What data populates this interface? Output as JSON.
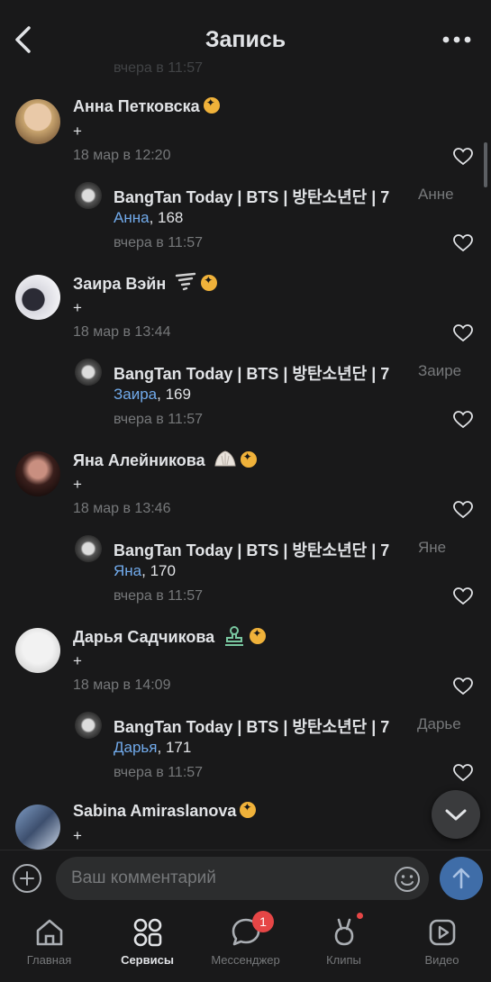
{
  "header": {
    "title": "Запись"
  },
  "faded_prev_date": "вчера в 11:57",
  "comments": [
    {
      "name": "Анна Петковска",
      "text": "+",
      "date": "18 мар в 12:20",
      "emoji": "",
      "reply": {
        "author": "BangTan Today | BTS | 방탄소년단 | 7",
        "to": "Анне",
        "mention": "Анна",
        "number": ", 168",
        "date": "вчера в 11:57"
      }
    },
    {
      "name": "Заира Вэйн",
      "text": "+",
      "date": "18 мар в 13:44",
      "emoji": "tornado-emoji",
      "reply": {
        "author": "BangTan Today | BTS | 방탄소년단 | 7",
        "to": "Заире",
        "mention": "Заира",
        "number": ", 169",
        "date": "вчера в 11:57"
      }
    },
    {
      "name": "Яна Алейникова",
      "text": "+",
      "date": "18 мар в 13:46",
      "emoji": "dumpling-emoji",
      "reply": {
        "author": "BangTan Today | BTS | 방탄소년단 | 7",
        "to": "Яне",
        "mention": "Яна",
        "number": ", 170",
        "date": "вчера в 11:57"
      }
    },
    {
      "name": "Дарья Садчикова",
      "text": "+",
      "date": "18 мар в 14:09",
      "emoji": "stamp-emoji",
      "reply": {
        "author": "BangTan Today | BTS | 방탄소년단 | 7",
        "to": "Дарье",
        "mention": "Дарья",
        "number": ", 171",
        "date": "вчера в 11:57"
      }
    },
    {
      "name": "Sabina Amiraslanova",
      "text": "+",
      "emoji": ""
    }
  ],
  "composer": {
    "placeholder": "Ваш комментарий"
  },
  "tabs": [
    {
      "label": "Главная",
      "icon": "home-icon"
    },
    {
      "label": "Сервисы",
      "icon": "services-icon",
      "active": true
    },
    {
      "label": "Мессенджер",
      "icon": "messenger-icon",
      "badge": "1"
    },
    {
      "label": "Клипы",
      "icon": "clips-icon"
    },
    {
      "label": "Видео",
      "icon": "video-icon"
    }
  ],
  "colors": {
    "background": "#19191a",
    "link": "#71aaeb",
    "badge": "#f0b23a",
    "notification": "#e64646",
    "send": "#3f6da8"
  }
}
